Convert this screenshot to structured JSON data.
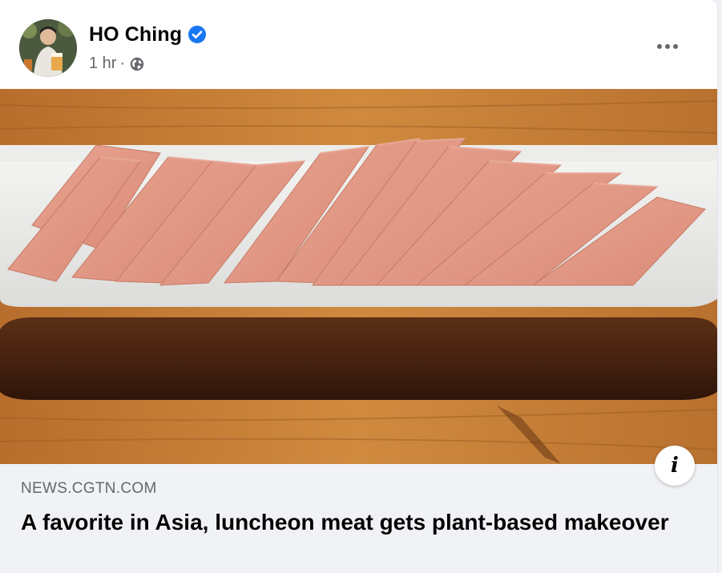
{
  "post": {
    "author": "HO Ching",
    "time": "1 hr",
    "separator": "·",
    "icons": {
      "verified": "verified-badge-icon",
      "audience": "globe-icon",
      "more": "more-options-icon",
      "info": "info-icon"
    },
    "colors": {
      "verified": "#1877f2",
      "meta": "#65676b",
      "link_bg": "#f0f2f5"
    }
  },
  "link_preview": {
    "domain": "NEWS.CGTN.COM",
    "headline": "A favorite in Asia, luncheon meat gets plant-based makeover"
  }
}
